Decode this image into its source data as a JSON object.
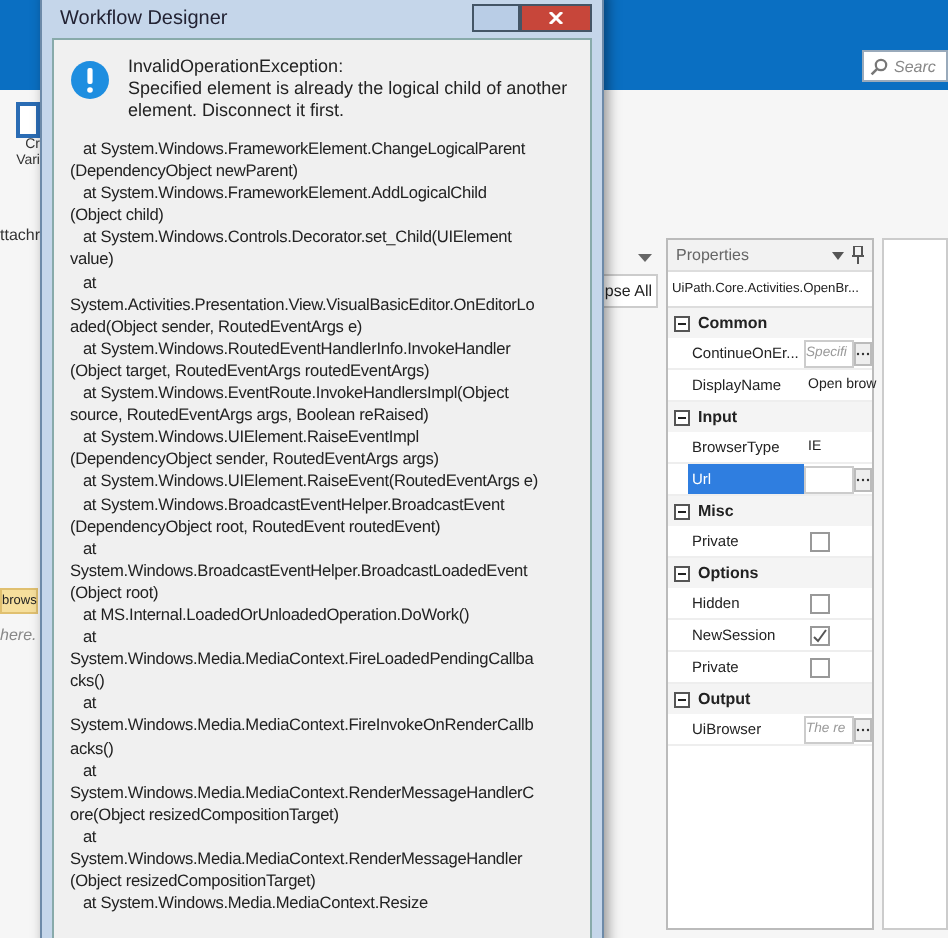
{
  "ribbon": {
    "search": {
      "placeholder": "Searc"
    }
  },
  "left_strip": {
    "ribbon_button_lines": [
      "Cr",
      "Vari"
    ],
    "tab": "ttachr",
    "tag": "brows",
    "hint": "here."
  },
  "designer_toolbar": {
    "button": "pse All"
  },
  "properties": {
    "title": "Properties",
    "subject": "UiPath.Core.Activities.OpenBr...",
    "categories": [
      {
        "name": "Common",
        "expanded": true,
        "rows": [
          {
            "name": "ContinueOnEr...",
            "kind": "expr",
            "placeholder": "Specifi",
            "selected": false
          },
          {
            "name": "DisplayName",
            "kind": "text",
            "value": "Open brow",
            "selected": false
          }
        ]
      },
      {
        "name": "Input",
        "expanded": true,
        "rows": [
          {
            "name": "BrowserType",
            "kind": "text",
            "value": "IE",
            "selected": false
          },
          {
            "name": "Url",
            "kind": "expr",
            "selected": true
          }
        ]
      },
      {
        "name": "Misc",
        "expanded": true,
        "rows": [
          {
            "name": "Private",
            "kind": "checkbox",
            "checked": false,
            "selected": false
          }
        ]
      },
      {
        "name": "Options",
        "expanded": true,
        "rows": [
          {
            "name": "Hidden",
            "kind": "checkbox",
            "checked": false,
            "selected": false
          },
          {
            "name": "NewSession",
            "kind": "checkbox",
            "checked": true,
            "selected": false
          },
          {
            "name": "Private",
            "kind": "checkbox",
            "checked": false,
            "selected": false
          }
        ]
      },
      {
        "name": "Output",
        "expanded": true,
        "rows": [
          {
            "name": "UiBrowser",
            "kind": "expr",
            "placeholder": "The re",
            "selected": false
          }
        ]
      }
    ]
  },
  "dialog": {
    "title": "Workflow Designer",
    "exception": "InvalidOperationException:",
    "message": "Specified element is already the logical child of another element. Disconnect it first.",
    "stack_trace": [
      "   at System.Windows.FrameworkElement.ChangeLogicalParent",
      "(DependencyObject newParent)",
      "   at System.Windows.FrameworkElement.AddLogicalChild",
      "(Object child)",
      "   at System.Windows.Controls.Decorator.set_Child(UIElement",
      "value)",
      "   at",
      "System.Activities.Presentation.View.VisualBasicEditor.OnEditorLo",
      "aded(Object sender, RoutedEventArgs e)",
      "   at System.Windows.RoutedEventHandlerInfo.InvokeHandler",
      "(Object target, RoutedEventArgs routedEventArgs)",
      "   at System.Windows.EventRoute.InvokeHandlersImpl(Object",
      "source, RoutedEventArgs args, Boolean reRaised)",
      "   at System.Windows.UIElement.RaiseEventImpl",
      "(DependencyObject sender, RoutedEventArgs args)",
      "   at System.Windows.UIElement.RaiseEvent(RoutedEventArgs e)",
      "   at System.Windows.BroadcastEventHelper.BroadcastEvent",
      "(DependencyObject root, RoutedEvent routedEvent)",
      "   at",
      "System.Windows.BroadcastEventHelper.BroadcastLoadedEvent",
      "(Object root)",
      "   at MS.Internal.LoadedOrUnloadedOperation.DoWork()",
      "   at",
      "System.Windows.Media.MediaContext.FireLoadedPendingCallba",
      "cks()",
      "   at",
      "System.Windows.Media.MediaContext.FireInvokeOnRenderCallb",
      "acks()",
      "   at",
      "System.Windows.Media.MediaContext.RenderMessageHandlerC",
      "ore(Object resizedCompositionTarget)",
      "   at",
      "System.Windows.Media.MediaContext.RenderMessageHandler",
      "(Object resizedCompositionTarget)",
      "   at System.Windows.Media.MediaContext.Resize"
    ]
  }
}
